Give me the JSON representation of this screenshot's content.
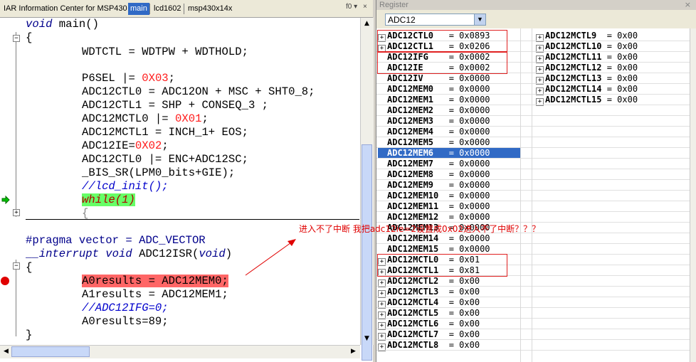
{
  "editor": {
    "tabs": [
      {
        "label": "IAR Information Center for MSP430"
      },
      {
        "label": "main"
      },
      {
        "label": "lcd1602"
      },
      {
        "label": "msp430x14x"
      }
    ],
    "tab_menu": "f0 ▾",
    "lines": [
      [
        "void main()"
      ],
      [
        "{"
      ],
      [
        "WDTCTL = WDTPW + WDTHOLD;"
      ],
      [
        ""
      ],
      [
        "P6SEL |= 0X03;"
      ],
      [
        "ADC12CTL0 = ADC12ON + MSC + SHT0_8;"
      ],
      [
        "ADC12CTL1 = SHP + CONSEQ_3 ;"
      ],
      [
        "ADC12MCTL0 |= 0X01;"
      ],
      [
        "ADC12MCTL1 = INCH_1+ EOS;"
      ],
      [
        "ADC12IE=0X02;"
      ],
      [
        "ADC12CTL0 |= ENC+ADC12SC;"
      ],
      [
        "_BIS_SR(LPM0_bits+GIE);"
      ],
      [
        "//lcd_init();"
      ],
      [
        "while(1)"
      ],
      [
        "{"
      ],
      [
        "#pragma vector = ADC_VECTOR"
      ],
      [
        "__interrupt void ADC12ISR(void)"
      ],
      [
        "{"
      ],
      [
        "A0results = ADC12MEM0;"
      ],
      [
        "A1results = ADC12MEM1;"
      ],
      [
        "//ADC12IFG=0;"
      ],
      [
        "A0results=89;"
      ],
      [
        "}"
      ]
    ],
    "annotation": "进入不了中断 我把adc12ie=2设置成0x02进入不了中断？？？"
  },
  "register": {
    "title": "Register",
    "group": "ADC12",
    "col1": [
      {
        "name": "ADC12CTL0",
        "value": "0x0893",
        "expand": true
      },
      {
        "name": "ADC12CTL1",
        "value": "0x0206",
        "expand": true
      },
      {
        "name": "ADC12IFG",
        "value": "0x0002",
        "expand": false
      },
      {
        "name": "ADC12IE",
        "value": "0x0002",
        "expand": false
      },
      {
        "name": "ADC12IV",
        "value": "0x0000",
        "expand": false
      },
      {
        "name": "ADC12MEM0",
        "value": "0x0000",
        "expand": false
      },
      {
        "name": "ADC12MEM1",
        "value": "0x0000",
        "expand": false
      },
      {
        "name": "ADC12MEM2",
        "value": "0x0000",
        "expand": false
      },
      {
        "name": "ADC12MEM3",
        "value": "0x0000",
        "expand": false
      },
      {
        "name": "ADC12MEM4",
        "value": "0x0000",
        "expand": false
      },
      {
        "name": "ADC12MEM5",
        "value": "0x0000",
        "expand": false
      },
      {
        "name": "ADC12MEM6",
        "value": "0x0000",
        "expand": false
      },
      {
        "name": "ADC12MEM7",
        "value": "0x0000",
        "expand": false
      },
      {
        "name": "ADC12MEM8",
        "value": "0x0000",
        "expand": false
      },
      {
        "name": "ADC12MEM9",
        "value": "0x0000",
        "expand": false
      },
      {
        "name": "ADC12MEM10",
        "value": "0x0000",
        "expand": false
      },
      {
        "name": "ADC12MEM11",
        "value": "0x0000",
        "expand": false
      },
      {
        "name": "ADC12MEM12",
        "value": "0x0000",
        "expand": false
      },
      {
        "name": "ADC12MEM13",
        "value": "0x0000",
        "expand": false
      },
      {
        "name": "ADC12MEM14",
        "value": "0x0000",
        "expand": false
      },
      {
        "name": "ADC12MEM15",
        "value": "0x0000",
        "expand": false
      },
      {
        "name": "ADC12MCTL0",
        "value": "0x01",
        "expand": true
      },
      {
        "name": "ADC12MCTL1",
        "value": "0x81",
        "expand": true
      },
      {
        "name": "ADC12MCTL2",
        "value": "0x00",
        "expand": true
      },
      {
        "name": "ADC12MCTL3",
        "value": "0x00",
        "expand": true
      },
      {
        "name": "ADC12MCTL4",
        "value": "0x00",
        "expand": true
      },
      {
        "name": "ADC12MCTL5",
        "value": "0x00",
        "expand": true
      },
      {
        "name": "ADC12MCTL6",
        "value": "0x00",
        "expand": true
      },
      {
        "name": "ADC12MCTL7",
        "value": "0x00",
        "expand": true
      },
      {
        "name": "ADC12MCTL8",
        "value": "0x00",
        "expand": true
      }
    ],
    "col2": [
      {
        "name": "ADC12MCTL9",
        "value": "0x00",
        "expand": true
      },
      {
        "name": "ADC12MCTL10",
        "value": "0x00",
        "expand": true
      },
      {
        "name": "ADC12MCTL11",
        "value": "0x00",
        "expand": true
      },
      {
        "name": "ADC12MCTL12",
        "value": "0x00",
        "expand": true
      },
      {
        "name": "ADC12MCTL13",
        "value": "0x00",
        "expand": true
      },
      {
        "name": "ADC12MCTL14",
        "value": "0x00",
        "expand": true
      },
      {
        "name": "ADC12MCTL15",
        "value": "0x00",
        "expand": true
      }
    ],
    "selected": "ADC12MEM6"
  },
  "colors": {
    "selection": "#316ac5",
    "annotation_red": "#e00000",
    "current_statement": "#66ff66",
    "breakpoint": "#ff6666",
    "keyword": "#00008b",
    "number": "#ff1a1a"
  }
}
